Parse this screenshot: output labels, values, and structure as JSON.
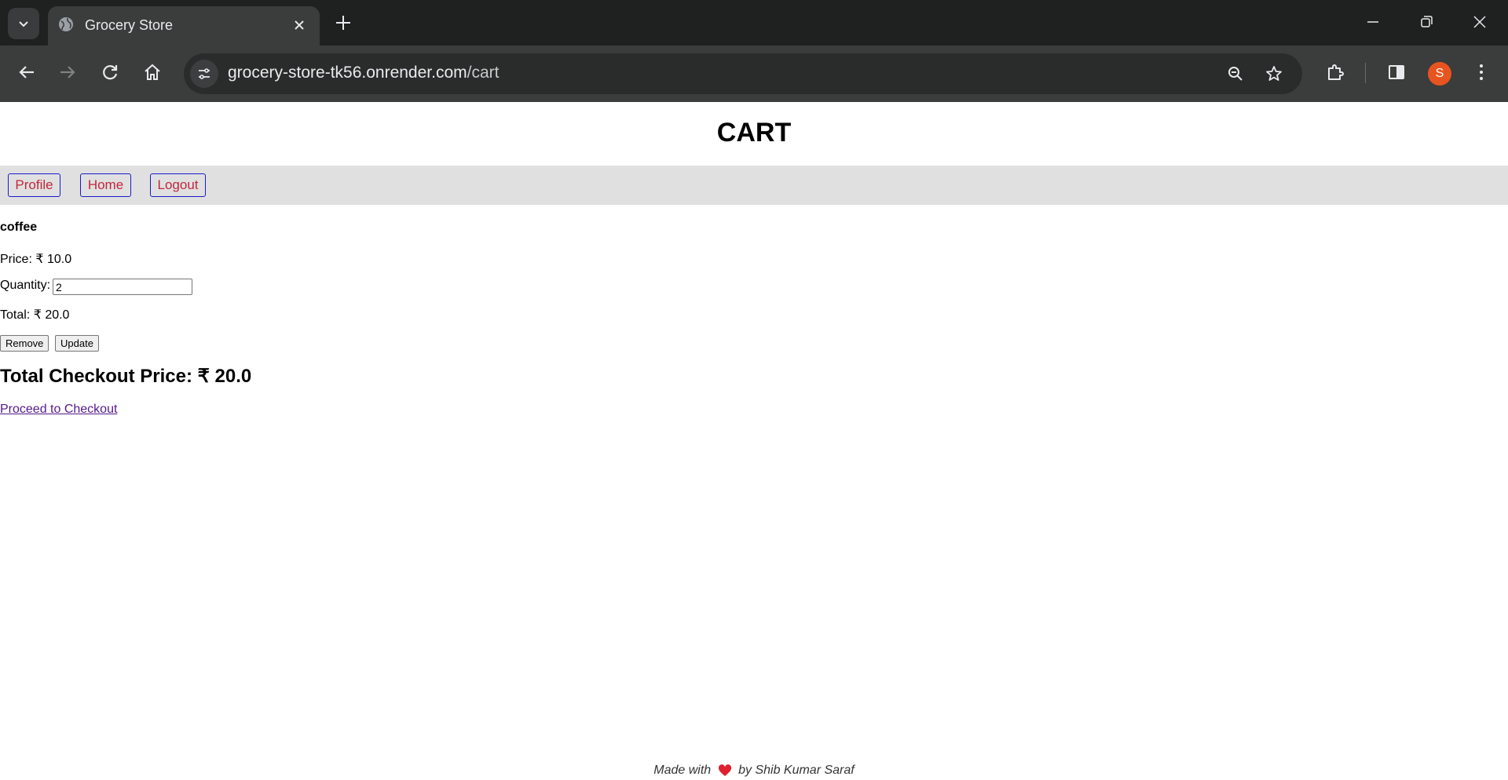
{
  "browser": {
    "tab_title": "Grocery Store",
    "url_host": "grocery-store-tk56.onrender.com",
    "url_path": "/cart",
    "profile_initial": "S",
    "icons": [
      "tab-search-icon",
      "globe-icon",
      "close-icon",
      "new-tab-icon",
      "minimize-icon",
      "restore-icon",
      "window-close-icon",
      "back-icon",
      "forward-icon",
      "reload-icon",
      "home-icon",
      "site-info-icon",
      "zoom-icon",
      "bookmark-star-icon",
      "extensions-icon",
      "side-panel-icon",
      "menu-icon"
    ]
  },
  "page": {
    "title": "CART",
    "nav": {
      "profile": "Profile",
      "home": "Home",
      "logout": "Logout"
    },
    "cart_item": {
      "name": "coffee",
      "price_label": "Price: ₹ 10.0",
      "quantity_label": "Quantity:",
      "quantity_value": "2",
      "total_label": "Total: ₹ 20.0",
      "remove_label": "Remove",
      "update_label": "Update"
    },
    "checkout_total": "Total Checkout Price: ₹ 20.0",
    "checkout_link": "Proceed to Checkout",
    "footer_before": "Made with",
    "footer_after": "by Shib Kumar Saraf"
  },
  "colors": {
    "chrome_bg": "#1f2020",
    "toolbar_bg": "#3b3c3c",
    "navbar_bg": "#e0e0e0",
    "nav_text": "#c1273f",
    "nav_border": "#1a1acc",
    "link_visited": "#551a8b",
    "heart": "#e0202e",
    "avatar": "#e8541f"
  }
}
